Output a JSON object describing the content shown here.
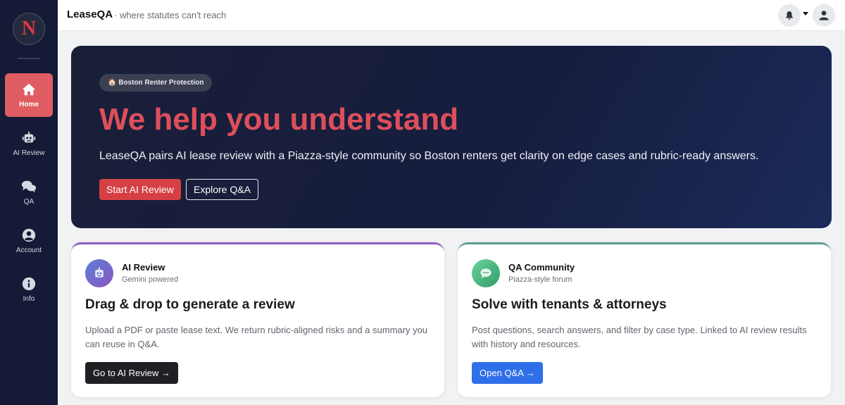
{
  "app": {
    "logo_letter": "N",
    "brand": "LeaseQA",
    "tagline": "· where statutes can't reach"
  },
  "sidebar": {
    "items": [
      {
        "label": "Home",
        "icon": "home-icon",
        "active": true
      },
      {
        "label": "AI Review",
        "icon": "robot-icon"
      },
      {
        "label": "QA",
        "icon": "chat-bubbles-icon"
      },
      {
        "label": "Account",
        "icon": "user-circle-icon"
      },
      {
        "label": "Info",
        "icon": "info-icon"
      }
    ]
  },
  "header": {
    "notification_icon": "bell-icon",
    "profile_icon": "user-icon"
  },
  "hero": {
    "badge": "🏠 Boston Renter Protection",
    "title": "We help you understand",
    "description": "LeaseQA pairs AI lease review with a Piazza-style community so Boston renters get clarity on edge cases and rubric-ready answers.",
    "primary_button": "Start AI Review",
    "secondary_button": "Explore Q&A"
  },
  "cards": [
    {
      "icon": "robot-icon",
      "name": "AI Review",
      "subtitle": "Gemini powered",
      "title": "Drag & drop to generate a review",
      "description": "Upload a PDF or paste lease text. We return rubric-aligned risks and a summary you can reuse in Q&A.",
      "button": "Go to AI Review →"
    },
    {
      "icon": "chat-bubble-icon",
      "name": "QA Community",
      "subtitle": "Piazza-style forum",
      "title": "Solve with tenants & attorneys",
      "description": "Post questions, search answers, and filter by case type. Linked to AI review results with history and resources.",
      "button": "Open Q&A →"
    }
  ],
  "colors": {
    "sidebar_bg": "#151a36",
    "active_nav": "#df5d63",
    "hero_title": "#dd4f5b",
    "primary_red": "#d63f44",
    "qa_blue": "#2f6fe8",
    "ai_accent": "#8a5fbf",
    "qa_accent": "#5a9f92"
  }
}
